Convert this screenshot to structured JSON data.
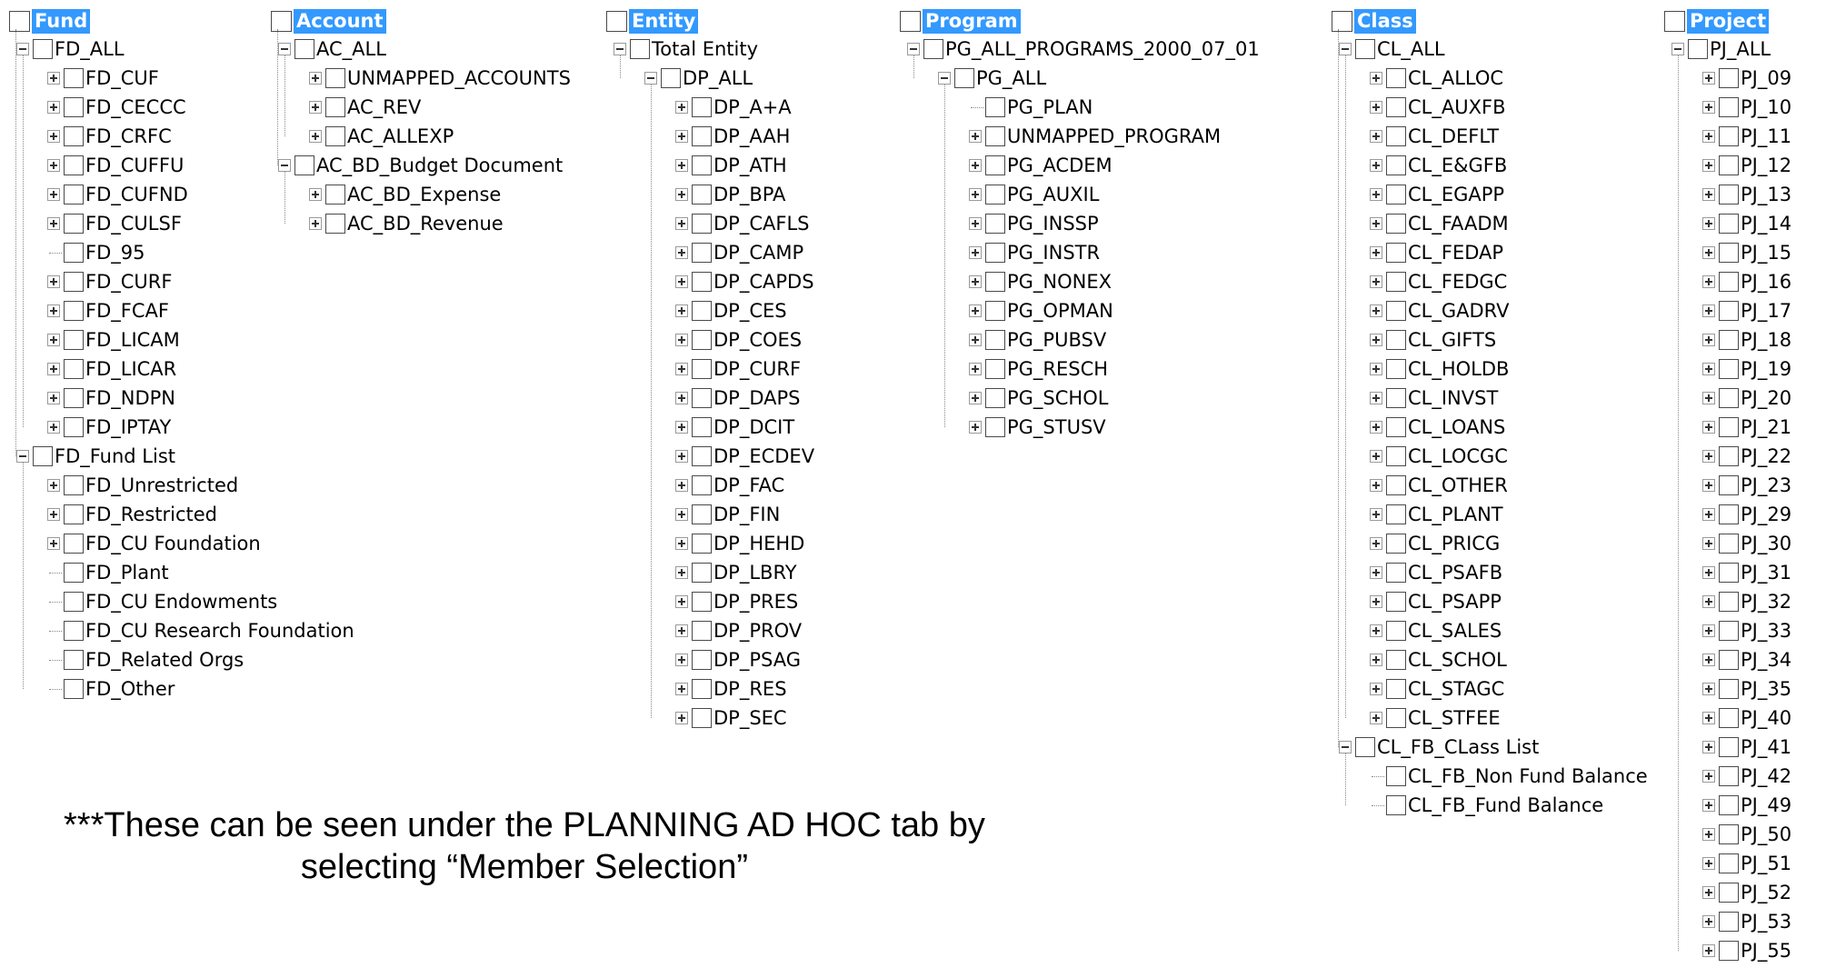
{
  "panels": [
    {
      "title": "Fund",
      "nodes": [
        {
          "label": "FD_ALL",
          "depth": 0,
          "exp": "minus"
        },
        {
          "label": "FD_CUF",
          "depth": 1,
          "exp": "plus"
        },
        {
          "label": "FD_CECCC",
          "depth": 1,
          "exp": "plus"
        },
        {
          "label": "FD_CRFC",
          "depth": 1,
          "exp": "plus"
        },
        {
          "label": "FD_CUFFU",
          "depth": 1,
          "exp": "plus"
        },
        {
          "label": "FD_CUFND",
          "depth": 1,
          "exp": "plus"
        },
        {
          "label": "FD_CULSF",
          "depth": 1,
          "exp": "plus"
        },
        {
          "label": "FD_95",
          "depth": 1,
          "exp": "none"
        },
        {
          "label": "FD_CURF",
          "depth": 1,
          "exp": "plus"
        },
        {
          "label": "FD_FCAF",
          "depth": 1,
          "exp": "plus"
        },
        {
          "label": "FD_LICAM",
          "depth": 1,
          "exp": "plus"
        },
        {
          "label": "FD_LICAR",
          "depth": 1,
          "exp": "plus"
        },
        {
          "label": "FD_NDPN",
          "depth": 1,
          "exp": "plus"
        },
        {
          "label": "FD_IPTAY",
          "depth": 1,
          "exp": "plus"
        },
        {
          "label": "FD_Fund List",
          "depth": 0,
          "exp": "minus"
        },
        {
          "label": "FD_Unrestricted",
          "depth": 1,
          "exp": "plus"
        },
        {
          "label": "FD_Restricted",
          "depth": 1,
          "exp": "plus"
        },
        {
          "label": "FD_CU Foundation",
          "depth": 1,
          "exp": "plus"
        },
        {
          "label": "FD_Plant",
          "depth": 1,
          "exp": "none"
        },
        {
          "label": "FD_CU Endowments",
          "depth": 1,
          "exp": "none"
        },
        {
          "label": "FD_CU Research Foundation",
          "depth": 1,
          "exp": "none"
        },
        {
          "label": "FD_Related Orgs",
          "depth": 1,
          "exp": "none"
        },
        {
          "label": "FD_Other",
          "depth": 1,
          "exp": "none"
        }
      ]
    },
    {
      "title": "Account",
      "nodes": [
        {
          "label": "AC_ALL",
          "depth": 0,
          "exp": "minus"
        },
        {
          "label": "UNMAPPED_ACCOUNTS",
          "depth": 1,
          "exp": "plus"
        },
        {
          "label": "AC_REV",
          "depth": 1,
          "exp": "plus"
        },
        {
          "label": "AC_ALLEXP",
          "depth": 1,
          "exp": "plus"
        },
        {
          "label": "AC_BD_Budget Document",
          "depth": 0,
          "exp": "minus"
        },
        {
          "label": "AC_BD_Expense",
          "depth": 1,
          "exp": "plus"
        },
        {
          "label": "AC_BD_Revenue",
          "depth": 1,
          "exp": "plus"
        }
      ]
    },
    {
      "title": "Entity",
      "nodes": [
        {
          "label": "Total Entity",
          "depth": 0,
          "exp": "minus"
        },
        {
          "label": "DP_ALL",
          "depth": 1,
          "exp": "minus"
        },
        {
          "label": "DP_A+A",
          "depth": 2,
          "exp": "plus"
        },
        {
          "label": "DP_AAH",
          "depth": 2,
          "exp": "plus"
        },
        {
          "label": "DP_ATH",
          "depth": 2,
          "exp": "plus"
        },
        {
          "label": "DP_BPA",
          "depth": 2,
          "exp": "plus"
        },
        {
          "label": "DP_CAFLS",
          "depth": 2,
          "exp": "plus"
        },
        {
          "label": "DP_CAMP",
          "depth": 2,
          "exp": "plus"
        },
        {
          "label": "DP_CAPDS",
          "depth": 2,
          "exp": "plus"
        },
        {
          "label": "DP_CES",
          "depth": 2,
          "exp": "plus"
        },
        {
          "label": "DP_COES",
          "depth": 2,
          "exp": "plus"
        },
        {
          "label": "DP_CURF",
          "depth": 2,
          "exp": "plus"
        },
        {
          "label": "DP_DAPS",
          "depth": 2,
          "exp": "plus"
        },
        {
          "label": "DP_DCIT",
          "depth": 2,
          "exp": "plus"
        },
        {
          "label": "DP_ECDEV",
          "depth": 2,
          "exp": "plus"
        },
        {
          "label": "DP_FAC",
          "depth": 2,
          "exp": "plus"
        },
        {
          "label": "DP_FIN",
          "depth": 2,
          "exp": "plus"
        },
        {
          "label": "DP_HEHD",
          "depth": 2,
          "exp": "plus"
        },
        {
          "label": "DP_LBRY",
          "depth": 2,
          "exp": "plus"
        },
        {
          "label": "DP_PRES",
          "depth": 2,
          "exp": "plus"
        },
        {
          "label": "DP_PROV",
          "depth": 2,
          "exp": "plus"
        },
        {
          "label": "DP_PSAG",
          "depth": 2,
          "exp": "plus"
        },
        {
          "label": "DP_RES",
          "depth": 2,
          "exp": "plus"
        },
        {
          "label": "DP_SEC",
          "depth": 2,
          "exp": "plus"
        }
      ]
    },
    {
      "title": "Program",
      "nodes": [
        {
          "label": "PG_ALL_PROGRAMS_2000_07_01",
          "depth": 0,
          "exp": "minus"
        },
        {
          "label": "PG_ALL",
          "depth": 1,
          "exp": "minus"
        },
        {
          "label": "PG_PLAN",
          "depth": 2,
          "exp": "none"
        },
        {
          "label": "UNMAPPED_PROGRAM",
          "depth": 2,
          "exp": "plus"
        },
        {
          "label": "PG_ACDEM",
          "depth": 2,
          "exp": "plus"
        },
        {
          "label": "PG_AUXIL",
          "depth": 2,
          "exp": "plus"
        },
        {
          "label": "PG_INSSP",
          "depth": 2,
          "exp": "plus"
        },
        {
          "label": "PG_INSTR",
          "depth": 2,
          "exp": "plus"
        },
        {
          "label": "PG_NONEX",
          "depth": 2,
          "exp": "plus"
        },
        {
          "label": "PG_OPMAN",
          "depth": 2,
          "exp": "plus"
        },
        {
          "label": "PG_PUBSV",
          "depth": 2,
          "exp": "plus"
        },
        {
          "label": "PG_RESCH",
          "depth": 2,
          "exp": "plus"
        },
        {
          "label": "PG_SCHOL",
          "depth": 2,
          "exp": "plus"
        },
        {
          "label": "PG_STUSV",
          "depth": 2,
          "exp": "plus"
        }
      ]
    },
    {
      "title": "Class",
      "nodes": [
        {
          "label": "CL_ALL",
          "depth": 0,
          "exp": "minus"
        },
        {
          "label": "CL_ALLOC",
          "depth": 1,
          "exp": "plus"
        },
        {
          "label": "CL_AUXFB",
          "depth": 1,
          "exp": "plus"
        },
        {
          "label": "CL_DEFLT",
          "depth": 1,
          "exp": "plus"
        },
        {
          "label": "CL_E&GFB",
          "depth": 1,
          "exp": "plus"
        },
        {
          "label": "CL_EGAPP",
          "depth": 1,
          "exp": "plus"
        },
        {
          "label": "CL_FAADM",
          "depth": 1,
          "exp": "plus"
        },
        {
          "label": "CL_FEDAP",
          "depth": 1,
          "exp": "plus"
        },
        {
          "label": "CL_FEDGC",
          "depth": 1,
          "exp": "plus"
        },
        {
          "label": "CL_GADRV",
          "depth": 1,
          "exp": "plus"
        },
        {
          "label": "CL_GIFTS",
          "depth": 1,
          "exp": "plus"
        },
        {
          "label": "CL_HOLDB",
          "depth": 1,
          "exp": "plus"
        },
        {
          "label": "CL_INVST",
          "depth": 1,
          "exp": "plus"
        },
        {
          "label": "CL_LOANS",
          "depth": 1,
          "exp": "plus"
        },
        {
          "label": "CL_LOCGC",
          "depth": 1,
          "exp": "plus"
        },
        {
          "label": "CL_OTHER",
          "depth": 1,
          "exp": "plus"
        },
        {
          "label": "CL_PLANT",
          "depth": 1,
          "exp": "plus"
        },
        {
          "label": "CL_PRICG",
          "depth": 1,
          "exp": "plus"
        },
        {
          "label": "CL_PSAFB",
          "depth": 1,
          "exp": "plus"
        },
        {
          "label": "CL_PSAPP",
          "depth": 1,
          "exp": "plus"
        },
        {
          "label": "CL_SALES",
          "depth": 1,
          "exp": "plus"
        },
        {
          "label": "CL_SCHOL",
          "depth": 1,
          "exp": "plus"
        },
        {
          "label": "CL_STAGC",
          "depth": 1,
          "exp": "plus"
        },
        {
          "label": "CL_STFEE",
          "depth": 1,
          "exp": "plus"
        },
        {
          "label": "CL_FB_CLass List",
          "depth": 0,
          "exp": "minus"
        },
        {
          "label": "CL_FB_Non Fund Balance",
          "depth": 1,
          "exp": "none"
        },
        {
          "label": "CL_FB_Fund Balance",
          "depth": 1,
          "exp": "none"
        }
      ]
    },
    {
      "title": "Project",
      "nodes": [
        {
          "label": "PJ_ALL",
          "depth": 0,
          "exp": "minus"
        },
        {
          "label": "PJ_09",
          "depth": 1,
          "exp": "plus"
        },
        {
          "label": "PJ_10",
          "depth": 1,
          "exp": "plus"
        },
        {
          "label": "PJ_11",
          "depth": 1,
          "exp": "plus"
        },
        {
          "label": "PJ_12",
          "depth": 1,
          "exp": "plus"
        },
        {
          "label": "PJ_13",
          "depth": 1,
          "exp": "plus"
        },
        {
          "label": "PJ_14",
          "depth": 1,
          "exp": "plus"
        },
        {
          "label": "PJ_15",
          "depth": 1,
          "exp": "plus"
        },
        {
          "label": "PJ_16",
          "depth": 1,
          "exp": "plus"
        },
        {
          "label": "PJ_17",
          "depth": 1,
          "exp": "plus"
        },
        {
          "label": "PJ_18",
          "depth": 1,
          "exp": "plus"
        },
        {
          "label": "PJ_19",
          "depth": 1,
          "exp": "plus"
        },
        {
          "label": "PJ_20",
          "depth": 1,
          "exp": "plus"
        },
        {
          "label": "PJ_21",
          "depth": 1,
          "exp": "plus"
        },
        {
          "label": "PJ_22",
          "depth": 1,
          "exp": "plus"
        },
        {
          "label": "PJ_23",
          "depth": 1,
          "exp": "plus"
        },
        {
          "label": "PJ_29",
          "depth": 1,
          "exp": "plus"
        },
        {
          "label": "PJ_30",
          "depth": 1,
          "exp": "plus"
        },
        {
          "label": "PJ_31",
          "depth": 1,
          "exp": "plus"
        },
        {
          "label": "PJ_32",
          "depth": 1,
          "exp": "plus"
        },
        {
          "label": "PJ_33",
          "depth": 1,
          "exp": "plus"
        },
        {
          "label": "PJ_34",
          "depth": 1,
          "exp": "plus"
        },
        {
          "label": "PJ_35",
          "depth": 1,
          "exp": "plus"
        },
        {
          "label": "PJ_40",
          "depth": 1,
          "exp": "plus"
        },
        {
          "label": "PJ_41",
          "depth": 1,
          "exp": "plus"
        },
        {
          "label": "PJ_42",
          "depth": 1,
          "exp": "plus"
        },
        {
          "label": "PJ_49",
          "depth": 1,
          "exp": "plus"
        },
        {
          "label": "PJ_50",
          "depth": 1,
          "exp": "plus"
        },
        {
          "label": "PJ_51",
          "depth": 1,
          "exp": "plus"
        },
        {
          "label": "PJ_52",
          "depth": 1,
          "exp": "plus"
        },
        {
          "label": "PJ_53",
          "depth": 1,
          "exp": "plus"
        },
        {
          "label": "PJ_55",
          "depth": 1,
          "exp": "plus"
        }
      ]
    }
  ],
  "note": {
    "line1": "***These can be seen under the PLANNING AD HOC tab by",
    "line2": "selecting “Member Selection”"
  },
  "colors": {
    "header_bg": "#3399ff",
    "header_text": "#ffffff"
  }
}
